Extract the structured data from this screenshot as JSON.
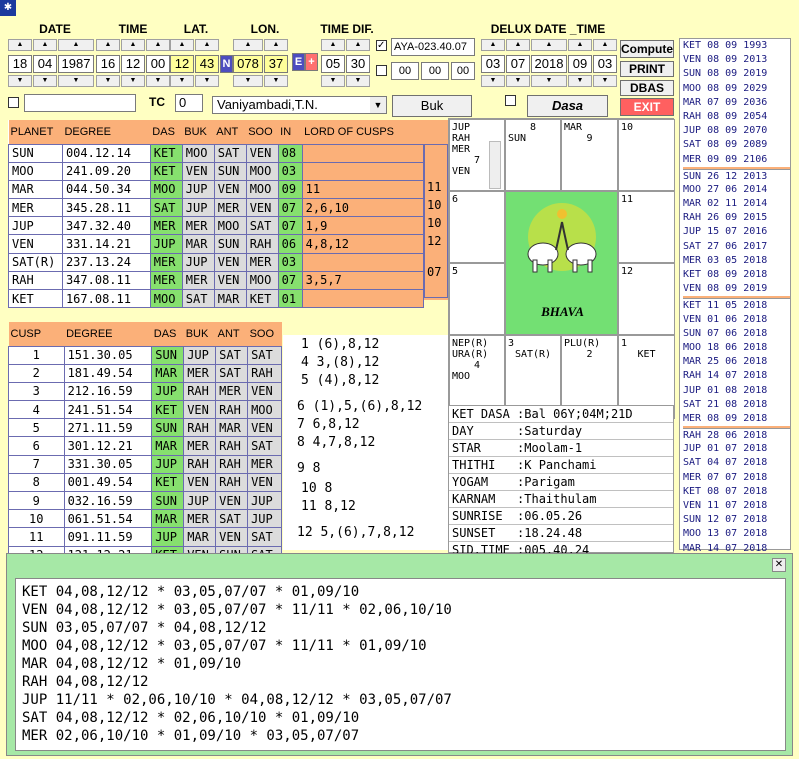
{
  "headers": {
    "date": "DATE",
    "time": "TIME",
    "lat": "LAT.",
    "lon": "LON.",
    "timedif": "TIME DIF.",
    "delux": "DELUX DATE _TIME"
  },
  "fields": {
    "d": "18",
    "m": "04",
    "y": "1987",
    "hh": "16",
    "mm": "12",
    "ss": "00",
    "lat1": "12",
    "lat2": "43",
    "latd": "N",
    "lon1": "078",
    "lon2": "37",
    "lond": "E",
    "tdsign": "+",
    "td1": "05",
    "td2": "30",
    "aya": "AYA-023.40.07",
    "ax1": "00",
    "ax2": "00",
    "ax3": "00",
    "dd": "03",
    "dm": "07",
    "dy": "2018",
    "dh": "09",
    "dmi": "03",
    "tclabel": "TC",
    "tcval": "0",
    "place": "Vaniyambadi,T.N."
  },
  "buttons": {
    "compute": "Compute",
    "print": "PRINT",
    "dbas": "DBAS",
    "exit": "EXIT",
    "buk": "Buk",
    "dasa": "Dasa"
  },
  "planet_headers": [
    "PLANET",
    "DEGREE",
    "DAS",
    "BUK",
    "ANT",
    "SOO",
    "IN",
    "LORD OF CUSPS"
  ],
  "planets": [
    [
      "SUN",
      "004.12.14",
      "KET",
      "MOO",
      "SAT",
      "VEN",
      "08",
      ""
    ],
    [
      "MOO",
      "241.09.20",
      "KET",
      "VEN",
      "SUN",
      "MOO",
      "03",
      ""
    ],
    [
      "MAR",
      "044.50.34",
      "MOO",
      "JUP",
      "VEN",
      "MOO",
      "09",
      "11"
    ],
    [
      "MER",
      "345.28.11",
      "SAT",
      "JUP",
      "MER",
      "VEN",
      "07",
      "2,6,10"
    ],
    [
      "JUP",
      "347.32.40",
      "MER",
      "MER",
      "MOO",
      "SAT",
      "07",
      "1,9"
    ],
    [
      "VEN",
      "331.14.21",
      "JUP",
      "MAR",
      "SUN",
      "RAH",
      "06",
      "4,8,12"
    ],
    [
      "SAT(R)",
      "237.13.24",
      "MER",
      "JUP",
      "VEN",
      "MER",
      "03",
      ""
    ],
    [
      "RAH",
      "347.08.11",
      "MER",
      "MER",
      "VEN",
      "MOO",
      "07",
      "3,5,7"
    ],
    [
      "KET",
      "167.08.11",
      "MOO",
      "SAT",
      "MAR",
      "KET",
      "01",
      ""
    ]
  ],
  "side_nums": [
    "11",
    "10",
    "10",
    "12",
    "07"
  ],
  "cusp_headers": [
    "CUSP",
    "DEGREE",
    "DAS",
    "BUK",
    "ANT",
    "SOO"
  ],
  "cusps": [
    [
      "1",
      "151.30.05",
      "SUN",
      "JUP",
      "SAT",
      "SAT"
    ],
    [
      "2",
      "181.49.54",
      "MAR",
      "MER",
      "SAT",
      "RAH"
    ],
    [
      "3",
      "212.16.59",
      "JUP",
      "RAH",
      "MER",
      "VEN"
    ],
    [
      "4",
      "241.51.54",
      "KET",
      "VEN",
      "RAH",
      "MOO"
    ],
    [
      "5",
      "271.11.59",
      "SUN",
      "RAH",
      "MAR",
      "VEN"
    ],
    [
      "6",
      "301.12.21",
      "MAR",
      "MER",
      "RAH",
      "SAT"
    ],
    [
      "7",
      "331.30.05",
      "JUP",
      "RAH",
      "RAH",
      "MER"
    ],
    [
      "8",
      "001.49.54",
      "KET",
      "VEN",
      "RAH",
      "VEN"
    ],
    [
      "9",
      "032.16.59",
      "SUN",
      "JUP",
      "VEN",
      "JUP"
    ],
    [
      "10",
      "061.51.54",
      "MAR",
      "MER",
      "SAT",
      "JUP"
    ],
    [
      "11",
      "091.11.59",
      "JUP",
      "MAR",
      "VEN",
      "SAT"
    ],
    [
      "12",
      "121.12.21",
      "KET",
      "VEN",
      "SUN",
      "SAT"
    ]
  ],
  "cusp_lords": [
    "1 (6),8,12",
    "4 3,(8),12",
    "5 (4),8,12",
    "6 (1),5,(6),8,12",
    "7 6,8,12",
    "8 4,7,8,12",
    "9 8",
    "10 8",
    "11 8,12",
    "12 5,(6),7,8,12"
  ],
  "chart": {
    "c1": [
      "JUP",
      "RAH",
      "MER",
      "7",
      "VEN"
    ],
    "c2": [
      "8",
      "SUN"
    ],
    "c3": [
      "MAR",
      "9"
    ],
    "c4": [
      "10"
    ],
    "c5": [
      "6"
    ],
    "c6": [
      "11"
    ],
    "c7": [
      "5"
    ],
    "c8": [
      "12"
    ],
    "c9": [
      "NEP(R)",
      "URA(R)",
      "4",
      "MOO"
    ],
    "c10": [
      "3",
      "SAT(R)"
    ],
    "c11": [
      "PLU(R)",
      "2"
    ],
    "c12": [
      "1",
      "KET"
    ],
    "center": "BHAVA"
  },
  "info": [
    "KET DASA :Bal 06Y;04M;21D",
    "DAY      :Saturday",
    "STAR     :Moolam-1",
    "THITHI   :K Panchami",
    "YOGAM    :Parigam",
    "KARNAM   :Thaithulam",
    "SUNRISE  :06.05.26",
    "SUNSET   :18.24.48",
    "SID.TIME :005.40.24"
  ],
  "dasa_list": [
    [
      "KET 08 09 1993",
      "VEN 08 09 2013",
      "SUN 08 09 2019",
      "MOO 08 09 2029",
      "MAR 07 09 2036",
      "RAH 08 09 2054",
      "JUP 08 09 2070",
      "SAT 08 09 2089",
      "MER 09 09 2106"
    ],
    [
      "SUN 26 12 2013",
      "MOO 27 06 2014",
      "MAR 02 11 2014",
      "RAH 26 09 2015",
      "JUP 15 07 2016",
      "SAT 27 06 2017",
      "MER 03 05 2018",
      "KET 08 09 2018",
      "VEN 08 09 2019"
    ],
    [
      "KET 11 05 2018",
      "VEN 01 06 2018",
      "SUN 07 06 2018",
      "MOO 18 06 2018",
      "MAR 25 06 2018",
      "RAH 14 07 2018",
      "JUP 01 08 2018",
      "SAT 21 08 2018",
      "MER 08 09 2018"
    ],
    [
      "RAH 28 06 2018",
      "JUP 01 07 2018",
      "SAT 04 07 2018",
      "MER 07 07 2018",
      "KET 08 07 2018",
      "VEN 11 07 2018",
      "SUN 12 07 2018",
      "MOO 13 07 2018",
      "MAR 14 07 2018"
    ]
  ],
  "bottom_lines": [
    "KET 04,08,12/12 * 03,05,07/07 * 01,09/10",
    "VEN 04,08,12/12 * 03,05,07/07 * 11/11 * 02,06,10/10",
    "SUN 03,05,07/07 * 04,08,12/12",
    "MOO 04,08,12/12 * 03,05,07/07 * 11/11 * 01,09/10",
    "MAR 04,08,12/12 * 01,09/10",
    "RAH 04,08,12/12",
    "JUP 11/11 * 02,06,10/10 * 04,08,12/12 * 03,05,07/07",
    "SAT 04,08,12/12 * 02,06,10/10 * 01,09/10",
    "MER 02,06,10/10 * 01,09/10 * 03,05,07/07"
  ]
}
